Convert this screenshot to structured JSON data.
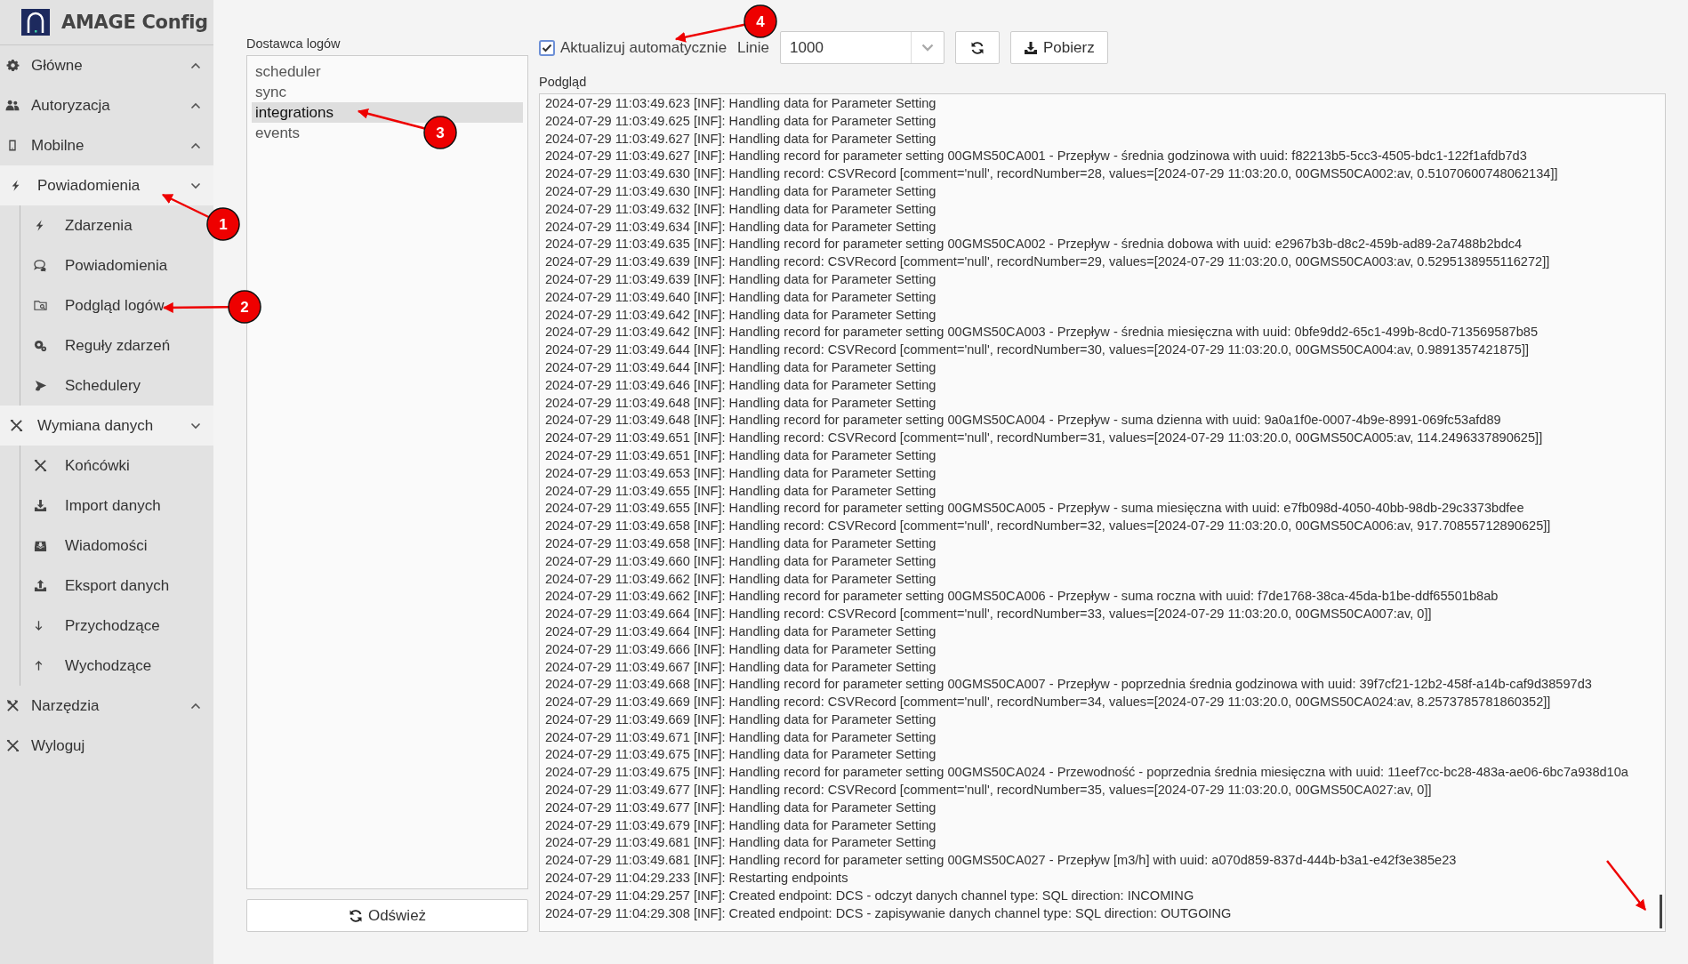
{
  "app": {
    "title": "AMAGE Config"
  },
  "sidebar": {
    "sections": [
      {
        "label": "Główne",
        "kind": "group",
        "expanded": false
      },
      {
        "label": "Autoryzacja",
        "kind": "group",
        "expanded": false
      },
      {
        "label": "Mobilne",
        "kind": "group",
        "expanded": false
      },
      {
        "label": "Powiadomienia",
        "kind": "group",
        "expanded": true,
        "children": [
          {
            "label": "Zdarzenia"
          },
          {
            "label": "Powiadomienia"
          },
          {
            "label": "Podgląd logów"
          },
          {
            "label": "Reguły zdarzeń"
          },
          {
            "label": "Schedulery"
          }
        ]
      },
      {
        "label": "Wymiana danych",
        "kind": "group",
        "expanded": true,
        "children": [
          {
            "label": "Końcówki"
          },
          {
            "label": "Import danych"
          },
          {
            "label": "Wiadomości"
          },
          {
            "label": "Eksport danych"
          },
          {
            "label": "Przychodzące"
          },
          {
            "label": "Wychodzące"
          }
        ]
      },
      {
        "label": "Narzędzia",
        "kind": "group",
        "expanded": false
      },
      {
        "label": "Wyloguj",
        "kind": "action"
      }
    ]
  },
  "log_provider": {
    "label": "Dostawca logów",
    "items": [
      {
        "label": "scheduler",
        "selected": false
      },
      {
        "label": "sync",
        "selected": false
      },
      {
        "label": "integrations",
        "selected": true
      },
      {
        "label": "events",
        "selected": false
      }
    ],
    "refresh_button": "Odśwież"
  },
  "toolbar": {
    "auto_update": {
      "label": "Aktualizuj automatycznie",
      "checked": true
    },
    "lines_label": "Linie",
    "lines_select": {
      "value": "1000"
    },
    "download_button": "Pobierz"
  },
  "preview": {
    "label": "Podgląd",
    "lines": [
      "2024-07-29 11:03:49.623 [INF]: Handling data for Parameter Setting",
      "2024-07-29 11:03:49.625 [INF]: Handling data for Parameter Setting",
      "2024-07-29 11:03:49.627 [INF]: Handling data for Parameter Setting",
      "2024-07-29 11:03:49.627 [INF]: Handling record for parameter setting 00GMS50CA001 - Przepływ - średnia godzinowa with uuid: f82213b5-5cc3-4505-bdc1-122f1afdb7d3",
      "2024-07-29 11:03:49.630 [INF]: Handling record: CSVRecord [comment='null', recordNumber=28, values=[2024-07-29 11:03:20.0, 00GMS50CA002:av, 0.51070600748062134]]",
      "2024-07-29 11:03:49.630 [INF]: Handling data for Parameter Setting",
      "2024-07-29 11:03:49.632 [INF]: Handling data for Parameter Setting",
      "2024-07-29 11:03:49.634 [INF]: Handling data for Parameter Setting",
      "2024-07-29 11:03:49.635 [INF]: Handling record for parameter setting 00GMS50CA002 - Przepływ - średnia dobowa with uuid: e2967b3b-d8c2-459b-ad89-2a7488b2bdc4",
      "2024-07-29 11:03:49.639 [INF]: Handling record: CSVRecord [comment='null', recordNumber=29, values=[2024-07-29 11:03:20.0, 00GMS50CA003:av, 0.5295138955116272]]",
      "2024-07-29 11:03:49.639 [INF]: Handling data for Parameter Setting",
      "2024-07-29 11:03:49.640 [INF]: Handling data for Parameter Setting",
      "2024-07-29 11:03:49.642 [INF]: Handling data for Parameter Setting",
      "2024-07-29 11:03:49.642 [INF]: Handling record for parameter setting 00GMS50CA003 - Przepływ - średnia miesięczna with uuid: 0bfe9dd2-65c1-499b-8cd0-713569587b85",
      "2024-07-29 11:03:49.644 [INF]: Handling record: CSVRecord [comment='null', recordNumber=30, values=[2024-07-29 11:03:20.0, 00GMS50CA004:av, 0.9891357421875]]",
      "2024-07-29 11:03:49.644 [INF]: Handling data for Parameter Setting",
      "2024-07-29 11:03:49.646 [INF]: Handling data for Parameter Setting",
      "2024-07-29 11:03:49.648 [INF]: Handling data for Parameter Setting",
      "2024-07-29 11:03:49.648 [INF]: Handling record for parameter setting 00GMS50CA004 - Przepływ - suma dzienna with uuid: 9a0a1f0e-0007-4b9e-8991-069fc53afd89",
      "2024-07-29 11:03:49.651 [INF]: Handling record: CSVRecord [comment='null', recordNumber=31, values=[2024-07-29 11:03:20.0, 00GMS50CA005:av, 114.2496337890625]]",
      "2024-07-29 11:03:49.651 [INF]: Handling data for Parameter Setting",
      "2024-07-29 11:03:49.653 [INF]: Handling data for Parameter Setting",
      "2024-07-29 11:03:49.655 [INF]: Handling data for Parameter Setting",
      "2024-07-29 11:03:49.655 [INF]: Handling record for parameter setting 00GMS50CA005 - Przepływ - suma miesięczna with uuid: e7fb098d-4050-40bb-98db-29c3373bdfee",
      "2024-07-29 11:03:49.658 [INF]: Handling record: CSVRecord [comment='null', recordNumber=32, values=[2024-07-29 11:03:20.0, 00GMS50CA006:av, 917.70855712890625]]",
      "2024-07-29 11:03:49.658 [INF]: Handling data for Parameter Setting",
      "2024-07-29 11:03:49.660 [INF]: Handling data for Parameter Setting",
      "2024-07-29 11:03:49.662 [INF]: Handling data for Parameter Setting",
      "2024-07-29 11:03:49.662 [INF]: Handling record for parameter setting 00GMS50CA006 - Przepływ - suma roczna with uuid: f7de1768-38ca-45da-b1be-ddf65501b8ab",
      "2024-07-29 11:03:49.664 [INF]: Handling record: CSVRecord [comment='null', recordNumber=33, values=[2024-07-29 11:03:20.0, 00GMS50CA007:av, 0]]",
      "2024-07-29 11:03:49.664 [INF]: Handling data for Parameter Setting",
      "2024-07-29 11:03:49.666 [INF]: Handling data for Parameter Setting",
      "2024-07-29 11:03:49.667 [INF]: Handling data for Parameter Setting",
      "2024-07-29 11:03:49.668 [INF]: Handling record for parameter setting 00GMS50CA007 - Przepływ - poprzednia średnia godzinowa with uuid: 39f7cf21-12b2-458f-a14b-caf9d38597d3",
      "2024-07-29 11:03:49.669 [INF]: Handling record: CSVRecord [comment='null', recordNumber=34, values=[2024-07-29 11:03:20.0, 00GMS50CA024:av, 8.2573785781860352]]",
      "2024-07-29 11:03:49.669 [INF]: Handling data for Parameter Setting",
      "2024-07-29 11:03:49.671 [INF]: Handling data for Parameter Setting",
      "2024-07-29 11:03:49.675 [INF]: Handling data for Parameter Setting",
      "2024-07-29 11:03:49.675 [INF]: Handling record for parameter setting 00GMS50CA024 - Przewodność - poprzednia średnia miesięczna with uuid: 11eef7cc-bc28-483a-ae06-6bc7a938d10a",
      "2024-07-29 11:03:49.677 [INF]: Handling record: CSVRecord [comment='null', recordNumber=35, values=[2024-07-29 11:03:20.0, 00GMS50CA027:av, 0]]",
      "2024-07-29 11:03:49.677 [INF]: Handling data for Parameter Setting",
      "2024-07-29 11:03:49.679 [INF]: Handling data for Parameter Setting",
      "2024-07-29 11:03:49.681 [INF]: Handling data for Parameter Setting",
      "2024-07-29 11:03:49.681 [INF]: Handling record for parameter setting 00GMS50CA027 - Przepływ [m3/h] with uuid: a070d859-837d-444b-b3a1-e42f3e385e23",
      "2024-07-29 11:04:29.233 [INF]: Restarting endpoints",
      "2024-07-29 11:04:29.257 [INF]: Created endpoint: DCS - odczyt danych channel type: SQL direction: INCOMING",
      "2024-07-29 11:04:29.308 [INF]: Created endpoint: DCS - zapisywanie danych channel type: SQL direction: OUTGOING"
    ]
  },
  "annotations": [
    {
      "kind": "numbered",
      "label": "1"
    },
    {
      "kind": "numbered",
      "label": "2"
    },
    {
      "kind": "numbered",
      "label": "3"
    },
    {
      "kind": "numbered",
      "label": "4"
    },
    {
      "kind": "arrow"
    }
  ]
}
